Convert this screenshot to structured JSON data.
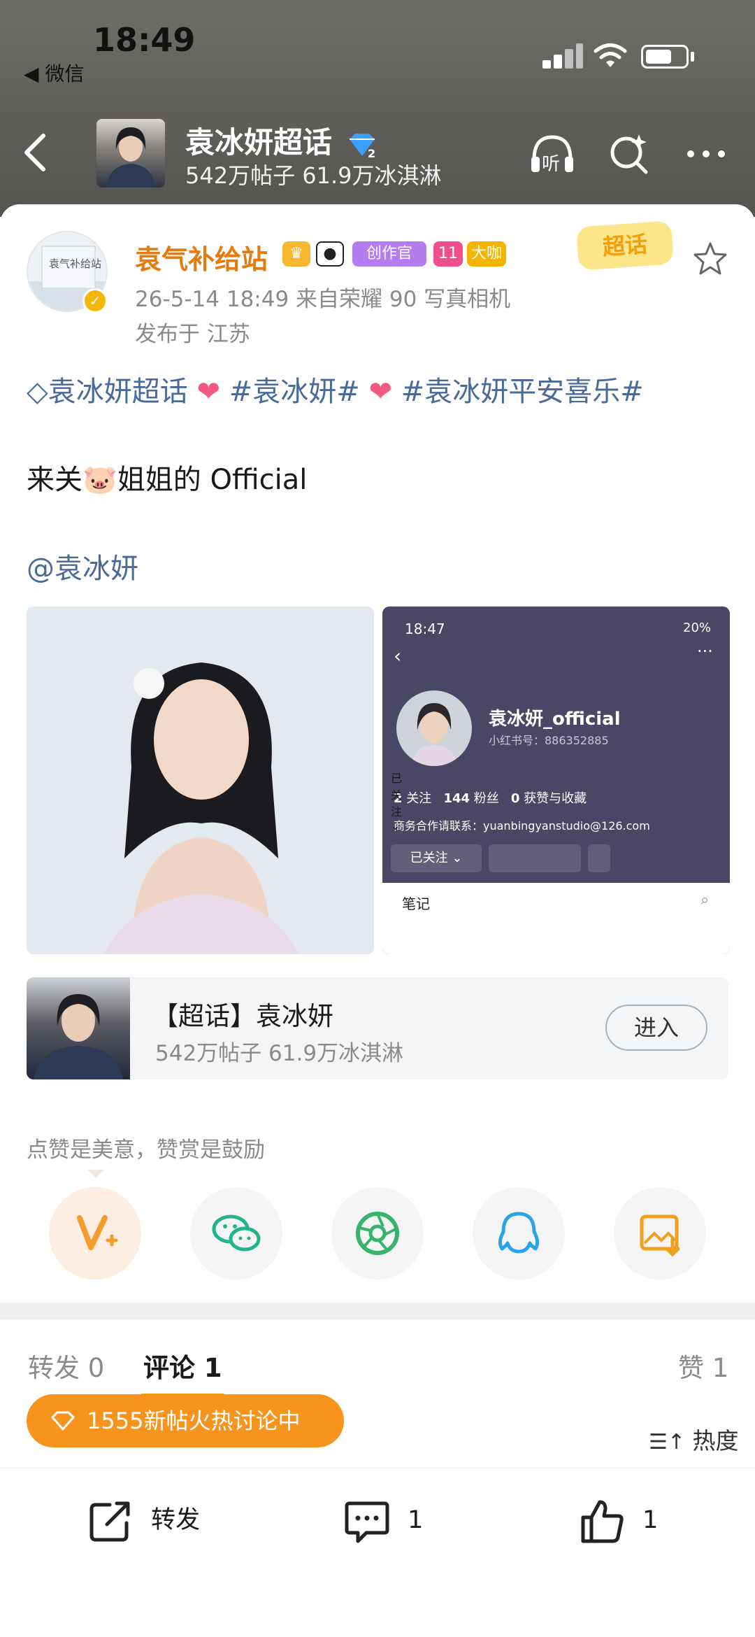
{
  "status": {
    "time": "18:49",
    "back_app": "◀ 微信"
  },
  "header": {
    "title": "袁冰妍超话",
    "subtitle": "542万帖子 61.9万冰淇淋",
    "listen_label": "听"
  },
  "post": {
    "author": "袁气补给站",
    "avatar_text": "袁气补给站",
    "badges": {
      "creator": "创作官",
      "vip_level": "11",
      "big": "大咖"
    },
    "stamp": "超话",
    "meta": "26-5-14 18:49  来自荣耀 90 写真相机",
    "location": "发布于 江苏",
    "topics": [
      "袁冰妍超话",
      "#袁冰妍#",
      "#袁冰妍平安喜乐#"
    ],
    "text_line_1": "来关",
    "pig_emoji": "🐷",
    "text_line_1_rest": "姐姐的 Official",
    "mention": "@袁冰妍"
  },
  "screenshot": {
    "time": "18:47",
    "battery": "20%",
    "name": "袁冰妍_official",
    "xhs_id": "小红书号：886352885",
    "following_count": "2",
    "following_label": "关注",
    "fans_count": "144",
    "fans_label": "粉丝",
    "likes_count": "0",
    "likes_label": "获赞与收藏",
    "contact": "商务合作请联系：yuanbingyanstudio@126.com",
    "follow_btn": "已关注 ⌄",
    "notes_tab": "笔记"
  },
  "topic_card": {
    "title": "【超话】袁冰妍",
    "stats": "542万帖子 61.9万冰淇淋",
    "enter_label": "进入"
  },
  "reward_hint": "点赞是美意，赞赏是鼓励",
  "share_icons": [
    "v-plus-icon",
    "wechat-icon",
    "moments-icon",
    "qq-icon",
    "save-image-icon"
  ],
  "tabs": {
    "repost": "转发 0",
    "comment": "评论 1",
    "like": "赞 1"
  },
  "hot_pill": "1555新帖火热讨论中",
  "sort_label": "热度",
  "bottom_bar": {
    "repost": "转发",
    "comment_count": "1",
    "like_count": "1"
  },
  "colors": {
    "accent_orange": "#f7941d",
    "topic_blue": "#4a6a9a",
    "author_orange": "#e57b0e"
  }
}
